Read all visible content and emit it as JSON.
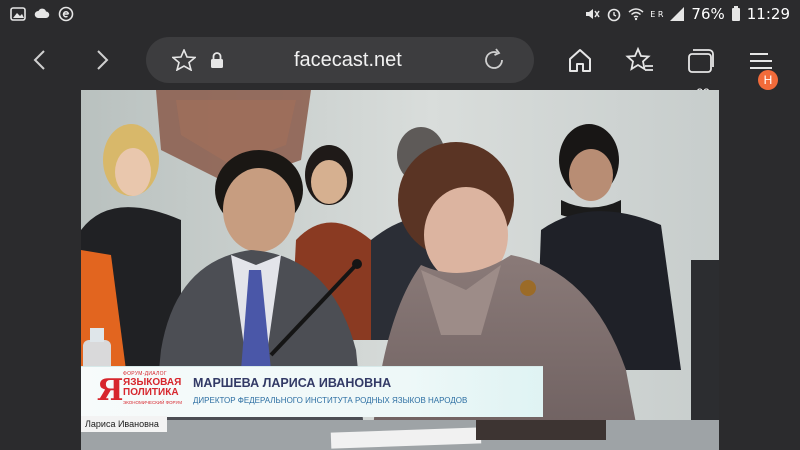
{
  "status_bar": {
    "battery": "76%",
    "time": "11:29",
    "network_letters": "E R",
    "icons": [
      "gallery-icon",
      "cloud-icon",
      "e-app-icon",
      "mute-icon",
      "alarm-icon",
      "wifi-icon",
      "signal-icon",
      "battery-icon"
    ]
  },
  "browser": {
    "url": "facecast.net",
    "tab_count": "22",
    "menu_badge": "H",
    "icons": [
      "back-icon",
      "forward-icon",
      "favorite-star-icon",
      "lock-icon",
      "reload-icon",
      "home-icon",
      "bookmarks-icon",
      "tabs-icon",
      "menu-icon"
    ]
  },
  "video": {
    "speaker_name": "МАРШЕВА ЛАРИСА ИВАНОВНА",
    "speaker_role": "ДИРЕКТОР ФЕДЕРАЛЬНОГО ИНСТИТУТА РОДНЫХ ЯЗЫКОВ НАРОДОВ",
    "logo_mark": "Я",
    "logo_small": "ФОРУМ-ДИАЛОГ",
    "logo_title_1": "ЯЗЫКОВАЯ",
    "logo_title_2": "ПОЛИТИКА",
    "logo_sub": "ЭКОНОМИЧЕСКИЙ ФОРУМ",
    "nameplate": "Лариса Ивановна"
  },
  "colors": {
    "chrome_bg": "#2b2b2d",
    "url_pill": "#3d3d3f",
    "badge": "#f26b3a",
    "logo_red": "#d7262d",
    "name_navy": "#333a66",
    "role_blue": "#2d6fa3"
  }
}
